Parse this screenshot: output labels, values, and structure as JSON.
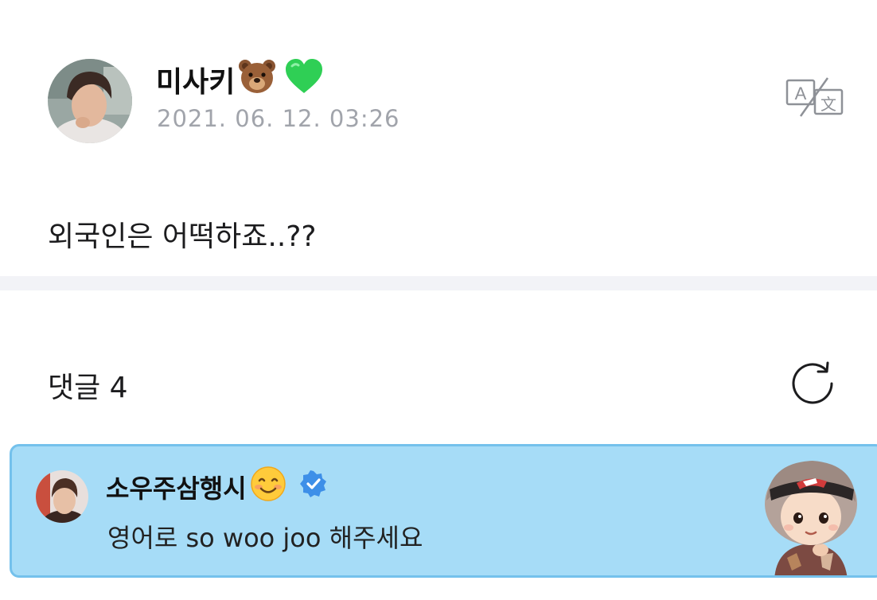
{
  "post": {
    "author": "미사키",
    "author_emojis": [
      "bear-face-icon",
      "green-heart-icon"
    ],
    "timestamp": "2021. 06. 12. 03:26",
    "body": "외국인은 어떡하죠..??",
    "translate_icon": "translate-icon"
  },
  "comments": {
    "title": "댓글 4",
    "refresh_icon": "refresh-icon",
    "highlighted": {
      "author": "소우주삼행시",
      "author_emoji": "smiling-face-icon",
      "verified_icon": "verified-badge-icon",
      "text": "영어로 so woo joo 해주세요",
      "background_color": "#a6dcf7",
      "border_color": "#74c1ec"
    }
  },
  "colors": {
    "timestamp": "#a1a4ab",
    "divider": "#f2f3f7",
    "verified": "#3d8fe8"
  }
}
